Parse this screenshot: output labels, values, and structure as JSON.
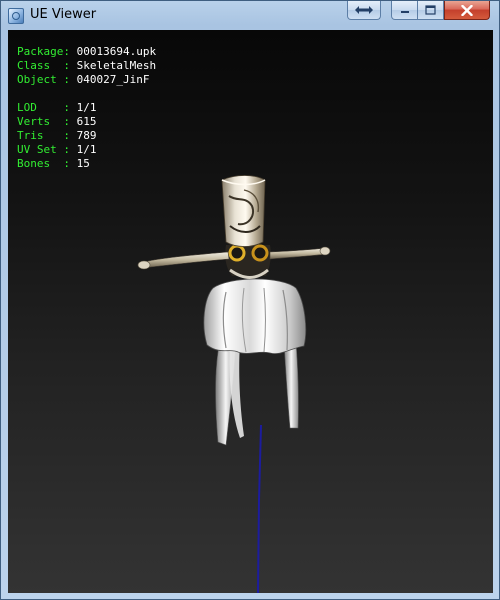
{
  "window": {
    "title": "UE Viewer",
    "controls": {
      "swap": "swap-arrows-icon",
      "minimize": "minimize-icon",
      "maximize": "maximize-icon",
      "close": "close-icon"
    }
  },
  "info": {
    "rows": [
      {
        "label": "Package",
        "sep": ": ",
        "value": "00013694.upk"
      },
      {
        "label": "Class  ",
        "sep": ": ",
        "value": "SkeletalMesh"
      },
      {
        "label": "Object ",
        "sep": ": ",
        "value": "040027_JinF"
      }
    ],
    "stats": [
      {
        "label": "LOD    ",
        "sep": ": ",
        "value": "1/1"
      },
      {
        "label": "Verts  ",
        "sep": ": ",
        "value": "615"
      },
      {
        "label": "Tris   ",
        "sep": ": ",
        "value": "789"
      },
      {
        "label": "UV Set ",
        "sep": ": ",
        "value": "1/1"
      },
      {
        "label": "Bones  ",
        "sep": ": ",
        "value": "15"
      }
    ]
  },
  "colors": {
    "label": "#32ee32",
    "value": "#ffffff",
    "axis": "#1c1c9e"
  }
}
